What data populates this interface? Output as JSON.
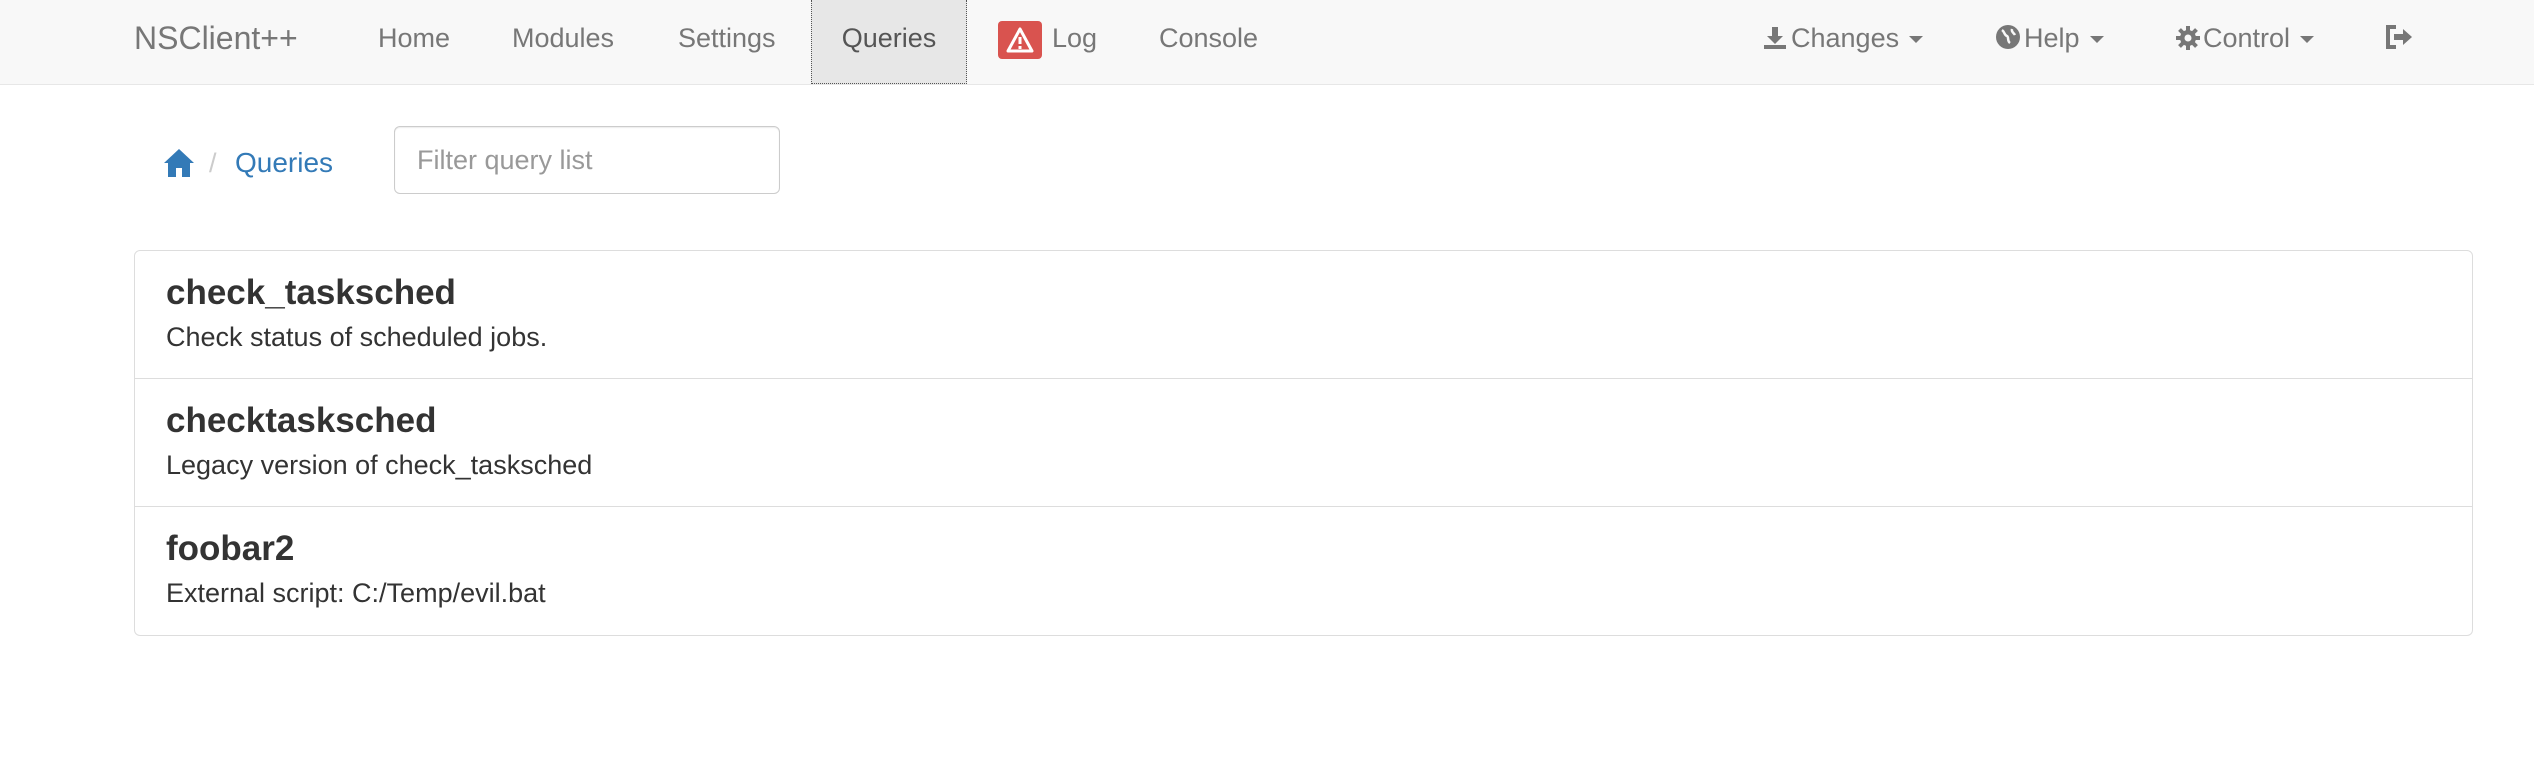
{
  "navbar": {
    "brand": "NSClient++",
    "links": {
      "home": "Home",
      "modules": "Modules",
      "settings": "Settings",
      "queries": "Queries",
      "log": "Log",
      "console": "Console"
    },
    "right": {
      "changes": "Changes",
      "help": "Help",
      "control": "Control"
    },
    "active": "Queries",
    "log_badge_color": "#d9534f"
  },
  "breadcrumb": {
    "separator": "/",
    "current": "Queries"
  },
  "filter": {
    "placeholder": "Filter query list",
    "value": ""
  },
  "queries": [
    {
      "name": "check_tasksched",
      "description": "Check status of scheduled jobs."
    },
    {
      "name": "checktasksched",
      "description": "Legacy version of check_tasksched"
    },
    {
      "name": "foobar2",
      "description": "External script: C:/Temp/evil.bat"
    }
  ],
  "colors": {
    "link": "#337ab7",
    "navbar_bg": "#f8f8f8",
    "danger": "#d9534f"
  }
}
